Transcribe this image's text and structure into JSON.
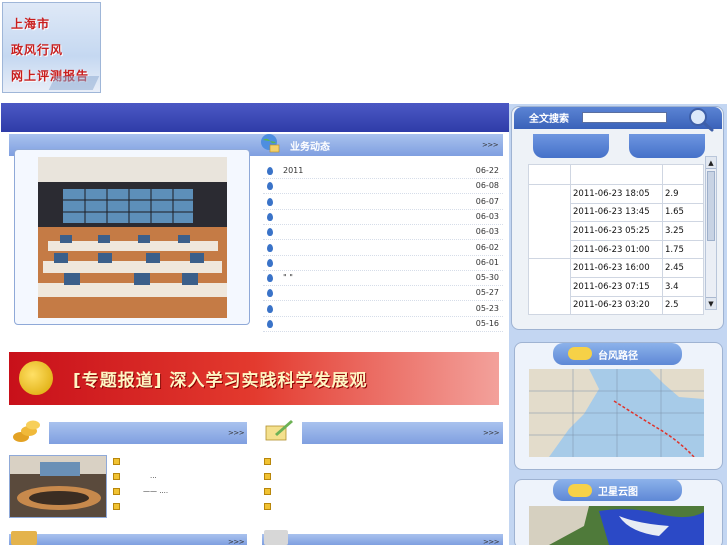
{
  "logo": {
    "line1": "上海市",
    "line2": "政风行风",
    "line3": "网上评测报告"
  },
  "news": {
    "title": "业务动态",
    "more": ">>>",
    "items": [
      {
        "text": "2011",
        "date": "06-22"
      },
      {
        "text": "",
        "date": "06-08"
      },
      {
        "text": "",
        "date": "06-07"
      },
      {
        "text": "",
        "date": "06-03"
      },
      {
        "text": "",
        "date": "06-03"
      },
      {
        "text": "",
        "date": "06-02"
      },
      {
        "text": "",
        "date": "06-01"
      },
      {
        "text": "\"                    \"",
        "date": "05-30"
      },
      {
        "text": "",
        "date": "05-27"
      },
      {
        "text": "",
        "date": "05-23"
      },
      {
        "text": "",
        "date": "05-16"
      }
    ]
  },
  "banner": {
    "text": "[专题报道] 深入学习实践科学发展观"
  },
  "lower_left": {
    "more": ">>>",
    "item1": "...",
    "item2": "—— ....",
    "more2": ">>>"
  },
  "lower_right": {
    "more": ">>>",
    "more2": ">>>"
  },
  "search": {
    "label": "全文搜索",
    "value": ""
  },
  "tide_table": {
    "headers": [
      "",
      "",
      ""
    ],
    "groups": [
      {
        "station": "",
        "rows": [
          {
            "time": "2011-06-23 18:05",
            "value": "2.9"
          },
          {
            "time": "2011-06-23 13:45",
            "value": "1.65"
          },
          {
            "time": "2011-06-23 05:25",
            "value": "3.25"
          },
          {
            "time": "2011-06-23 01:00",
            "value": "1.75"
          }
        ]
      },
      {
        "station": "",
        "rows": [
          {
            "time": "2011-06-23 16:00",
            "value": "2.45"
          },
          {
            "time": "2011-06-23 07:15",
            "value": "3.4"
          },
          {
            "time": "2011-06-23 03:20",
            "value": "2.5"
          }
        ]
      }
    ]
  },
  "typhoon": {
    "title": "台风路径"
  },
  "satellite": {
    "title": "卫星云图"
  },
  "colors": {
    "topbar": "#3a46b4",
    "accent": "#7f9fe0",
    "banner": "#d5201f"
  }
}
